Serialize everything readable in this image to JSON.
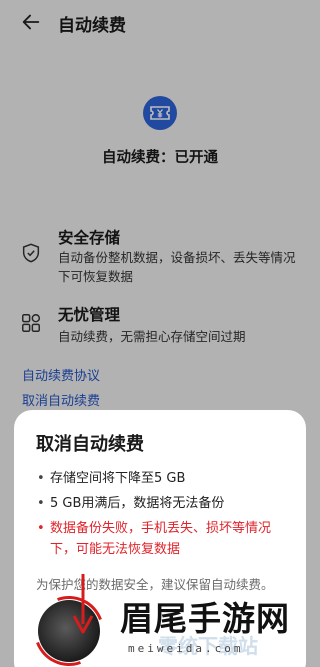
{
  "header": {
    "title": "自动续费",
    "back_icon": "back-arrow-icon"
  },
  "status": {
    "icon": "ticket-yen-icon",
    "text": "自动续费：已开通",
    "accent": "#2f63d8"
  },
  "features": [
    {
      "icon": "shield-check-icon",
      "title": "安全存储",
      "desc": "自动备份整机数据，设备损坏、丢失等情况下可恢复数据"
    },
    {
      "icon": "apps-grid-icon",
      "title": "无忧管理",
      "desc": "自动续费，无需担心存储空间过期"
    }
  ],
  "links": {
    "agreement": "自动续费协议",
    "cancel": "取消自动续费",
    "color": "#2456c6"
  },
  "dialog": {
    "title": "取消自动续费",
    "bullets": [
      {
        "text": "存储空间将下降至5 GB",
        "warn": false
      },
      {
        "text": "5 GB用满后，数据将无法备份",
        "warn": false
      },
      {
        "text": "数据备份失败，手机丢失、损坏等情况下，可能无法恢复数据",
        "warn": true
      }
    ],
    "note": "为保护您的数据安全，建议保留自动续费。",
    "warn_color": "#e0242b"
  },
  "watermark": {
    "title": "眉尾手游网",
    "url": "meiweida.com",
    "faint": "零统下载站"
  }
}
